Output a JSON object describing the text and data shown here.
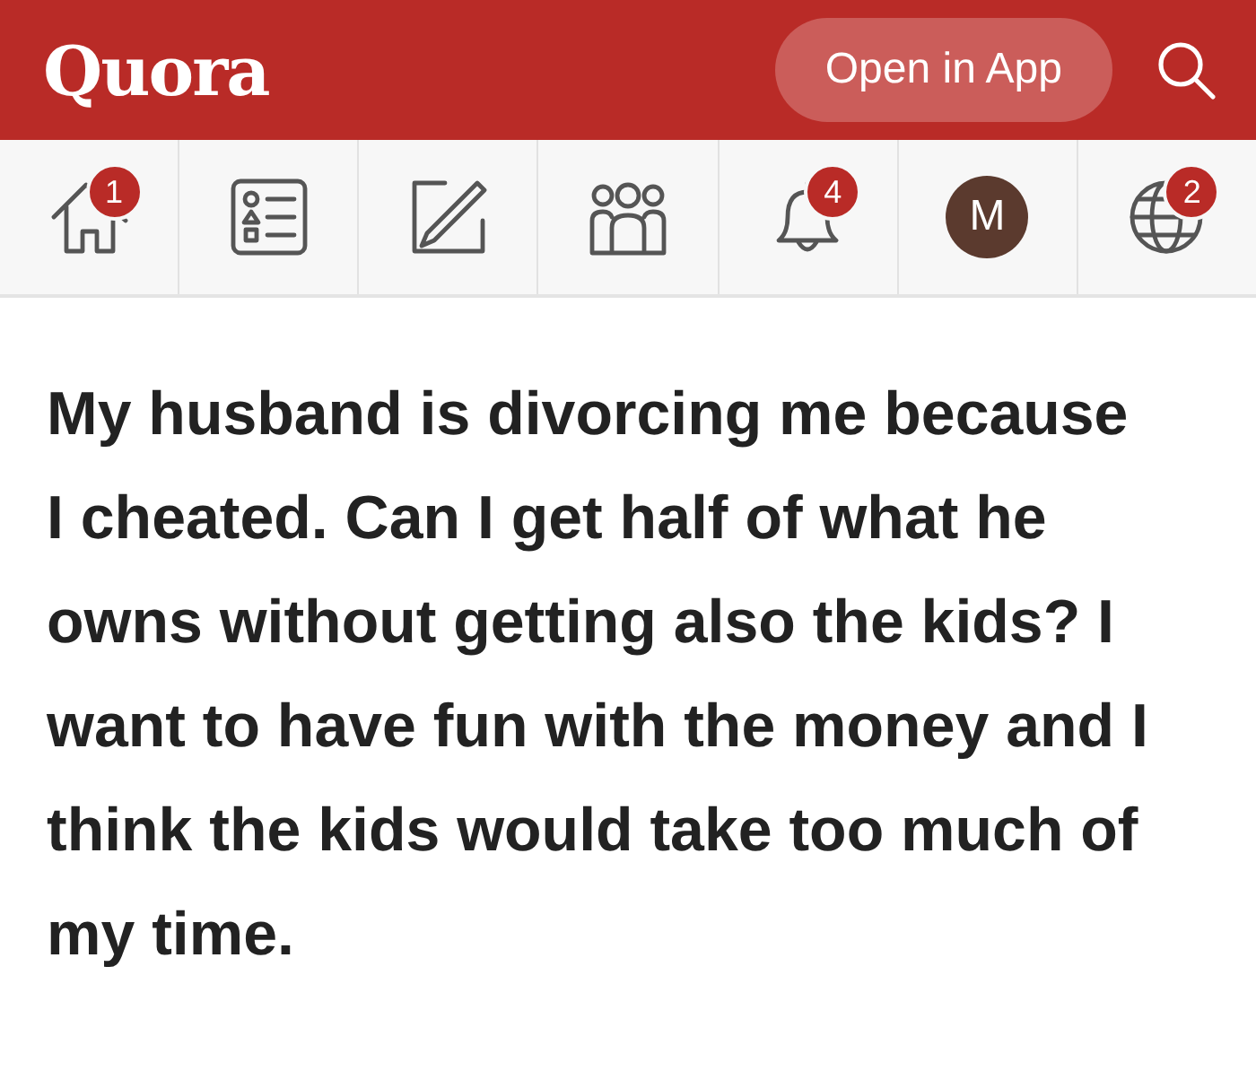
{
  "header": {
    "logo": "Quora",
    "open_in_app": "Open in App"
  },
  "nav": [
    {
      "kind": "home",
      "badge": "1"
    },
    {
      "kind": "list"
    },
    {
      "kind": "write"
    },
    {
      "kind": "people"
    },
    {
      "kind": "bell",
      "badge": "4"
    },
    {
      "kind": "avatar",
      "initial": "M",
      "color": "#5b3a2e"
    },
    {
      "kind": "globe",
      "badge": "2"
    }
  ],
  "question": "My husband is divorcing me because I cheated. Can I get half of what he owns without getting also the kids? I want to have fun with the money and I think the kids would take too much of my time."
}
